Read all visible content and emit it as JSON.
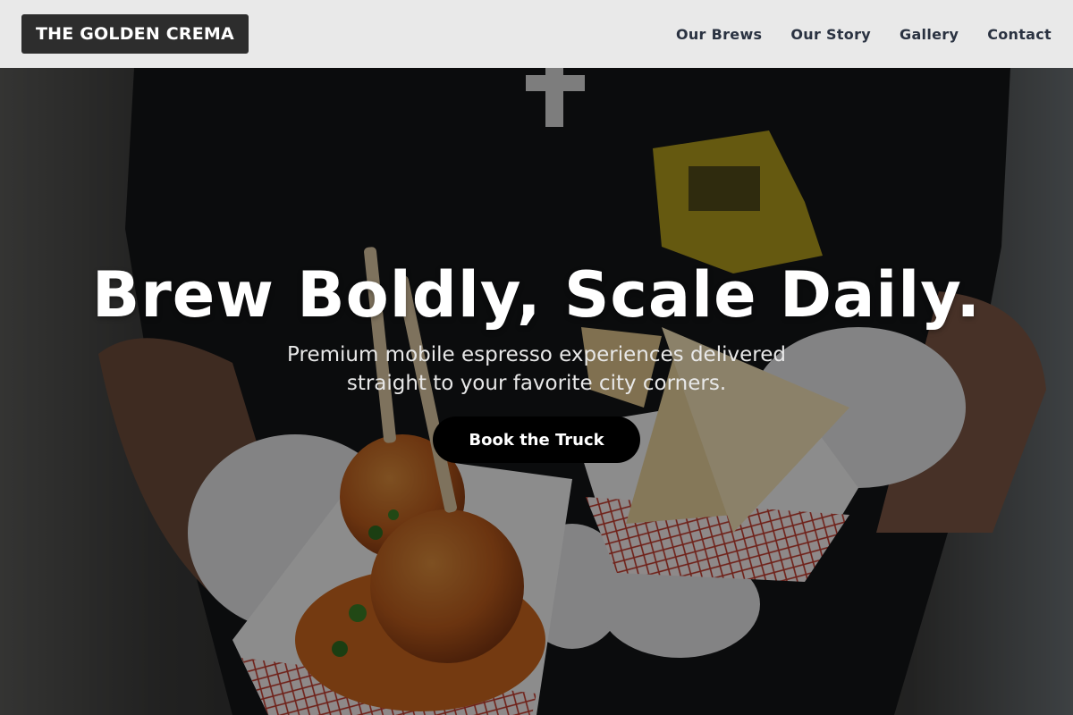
{
  "header": {
    "logo_text": "THE GOLDEN CREMA",
    "nav": [
      {
        "label": "Our Brews"
      },
      {
        "label": "Our Story"
      },
      {
        "label": "Gallery"
      },
      {
        "label": "Contact"
      }
    ]
  },
  "hero": {
    "title": "Brew Boldly, Scale Daily.",
    "subtitle": "Premium mobile espresso experiences delivered straight to your favorite city corners.",
    "cta_label": "Book the Truck",
    "background_image": "person-holding-meatballs-and-samosas-photo"
  },
  "colors": {
    "header_bg": "#e9e9e9",
    "logo_bg": "#2d2d2d",
    "nav_text": "#2a3241",
    "cta_bg": "#000000",
    "hero_text": "#ffffff"
  }
}
